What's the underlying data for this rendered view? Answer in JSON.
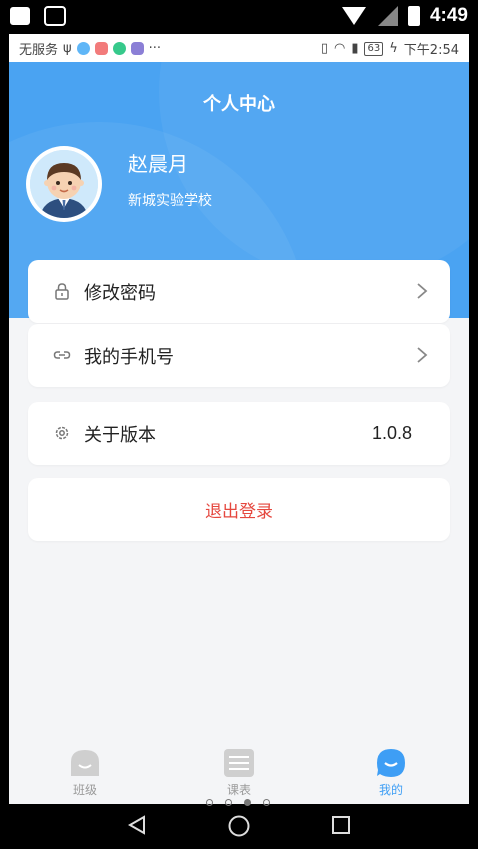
{
  "system_status": {
    "time": "4:49"
  },
  "app_status": {
    "carrier": "无服务",
    "usb": "ψ",
    "more": "···",
    "battery": "63",
    "time": "下午2:54"
  },
  "header": {
    "title": "个人中心",
    "user_name": "赵晨月",
    "school": "新城实验学校"
  },
  "menu": {
    "change_password": "修改密码",
    "my_phone": "我的手机号",
    "about_version": "关于版本",
    "version": "1.0.8",
    "logout": "退出登录"
  },
  "tabs": [
    {
      "label": "班级",
      "icon": "class-icon"
    },
    {
      "label": "课表",
      "icon": "schedule-icon"
    },
    {
      "label": "我的",
      "icon": "me-icon"
    }
  ],
  "colors": {
    "primary": "#4aa3f2",
    "logout_text": "#e5473e",
    "active_tab": "#3e9ef5"
  }
}
